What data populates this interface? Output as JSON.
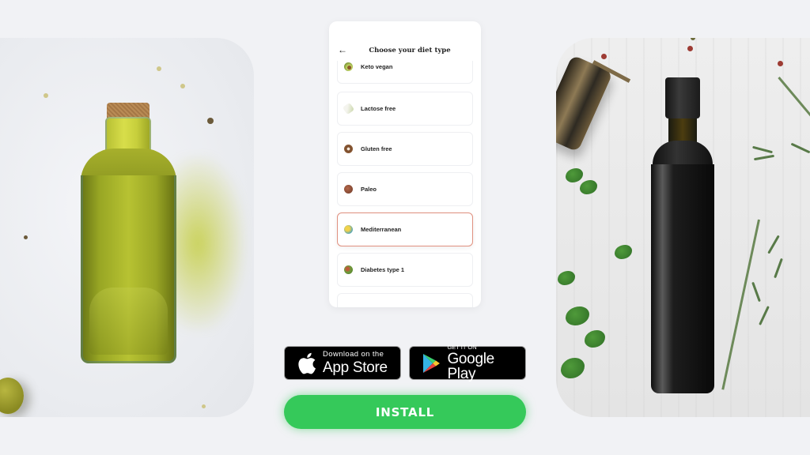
{
  "phone": {
    "back_icon": "arrow-left-icon",
    "title": "Choose your diet type",
    "diet_options": [
      {
        "label": "Keto vegan",
        "icon": "avocado-icon",
        "selected": false
      },
      {
        "label": "Lactose free",
        "icon": "milk-bottle-icon",
        "selected": false
      },
      {
        "label": "Gluten free",
        "icon": "donut-icon",
        "selected": false
      },
      {
        "label": "Paleo",
        "icon": "meat-icon",
        "selected": false
      },
      {
        "label": "Mediterranean",
        "icon": "fish-icon",
        "selected": true
      },
      {
        "label": "Diabetes type 1",
        "icon": "salad-icon",
        "selected": false
      },
      {
        "label": "",
        "icon": "",
        "selected": false
      }
    ]
  },
  "badges": {
    "app_store": {
      "small": "Download on the",
      "big": "App Store",
      "icon": "apple-icon"
    },
    "google_play": {
      "small": "GET IT ON",
      "big": "Google Play",
      "icon": "play-store-icon"
    }
  },
  "install_button": {
    "label": "INSTALL",
    "color": "#35C95A"
  },
  "colors": {
    "background": "#F1F2F5",
    "selected_border": "#E0907F"
  },
  "images": {
    "left": "olive-oil-bottle-photo",
    "right": "dark-oil-bottle-with-herbs-photo"
  }
}
